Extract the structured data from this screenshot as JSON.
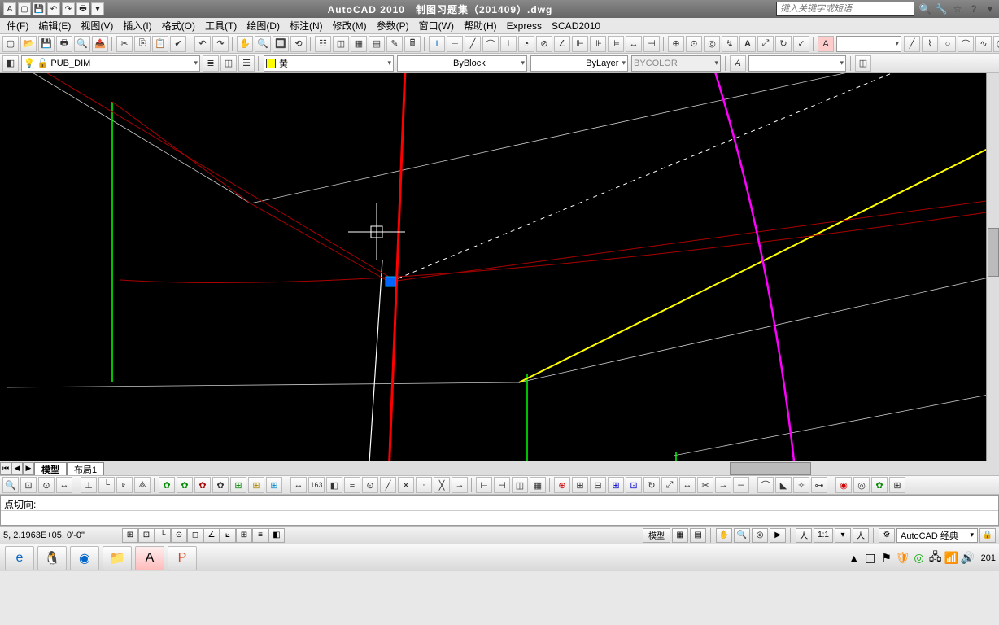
{
  "title_bar": {
    "app": "AutoCAD 2010",
    "file": "制图习题集（201409）.dwg",
    "search_placeholder": "键入关键字或短语"
  },
  "menu": {
    "items": [
      {
        "label": "件(F)"
      },
      {
        "label": "编辑(E)"
      },
      {
        "label": "视图(V)"
      },
      {
        "label": "插入(I)"
      },
      {
        "label": "格式(O)"
      },
      {
        "label": "工具(T)"
      },
      {
        "label": "绘图(D)"
      },
      {
        "label": "标注(N)"
      },
      {
        "label": "修改(M)"
      },
      {
        "label": "参数(P)"
      },
      {
        "label": "窗口(W)"
      },
      {
        "label": "帮助(H)"
      },
      {
        "label": "Express"
      },
      {
        "label": "SCAD2010"
      }
    ]
  },
  "toolbars": {
    "layer_combo": "PUB_DIM",
    "color_label": "黄",
    "linetype": "ByBlock",
    "lineweight": "ByLayer",
    "plotstyle": "BYCOLOR"
  },
  "tabs": {
    "model": "模型",
    "layout1": "布局1"
  },
  "command": {
    "prompt": "点切向:"
  },
  "status": {
    "coords": "5, 2.1963E+05, 0'-0\"",
    "model_label": "模型 ",
    "scale": "1:1",
    "workspace": "AutoCAD 经典",
    "clock": "201"
  },
  "taskbar": {
    "clock_partial": "201"
  }
}
